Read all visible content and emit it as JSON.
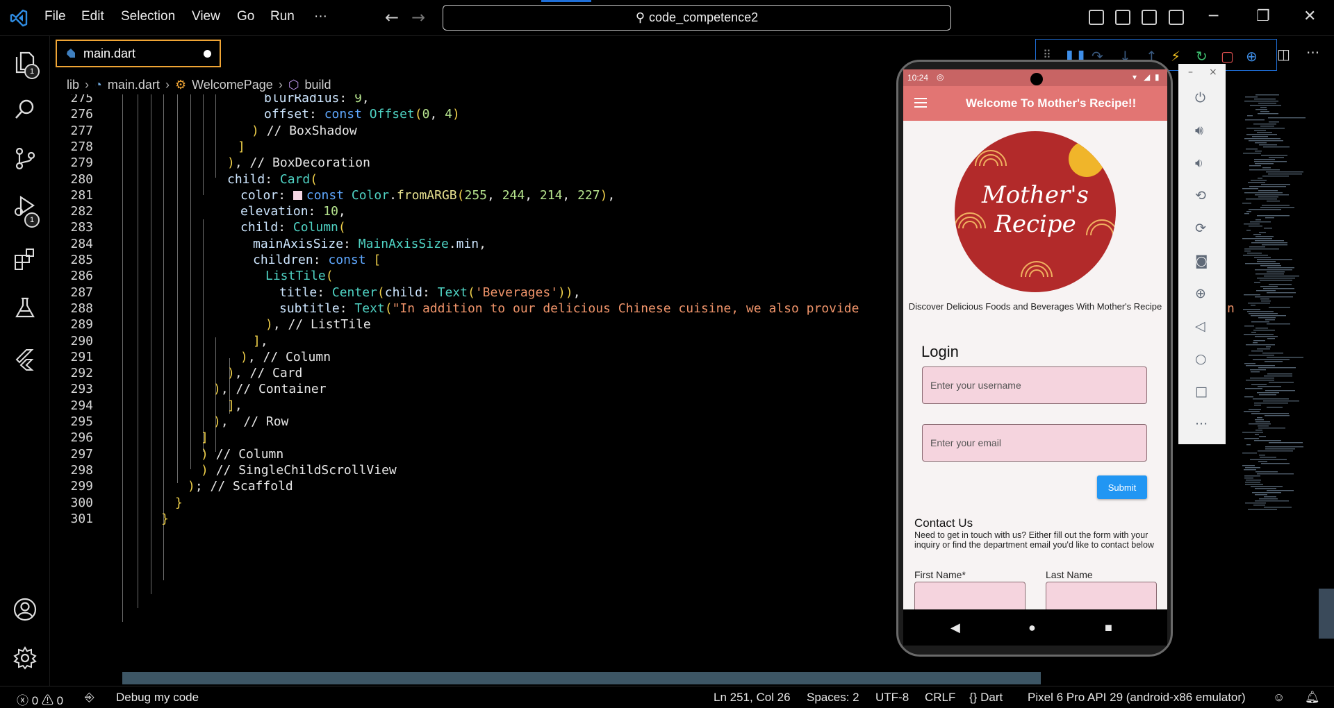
{
  "window": {
    "search_text": "code_competence2"
  },
  "menu": [
    "File",
    "Edit",
    "Selection",
    "View",
    "Go",
    "Run",
    "···"
  ],
  "tab": {
    "filename": "main.dart"
  },
  "breadcrumb": {
    "folder": "lib",
    "file": "main.dart",
    "class": "WelcomePage",
    "method": "build"
  },
  "code_lines": [
    {
      "num": "275",
      "text": "blurRadius: 9,"
    },
    {
      "num": "276",
      "text": "offset: const Offset(0, 4)"
    },
    {
      "num": "277",
      "text": ") // BoxShadow"
    },
    {
      "num": "278",
      "text": "]"
    },
    {
      "num": "279",
      "text": "), // BoxDecoration"
    },
    {
      "num": "280",
      "text": "child: Card("
    },
    {
      "num": "281",
      "text": "color: const Color.fromARGB(255, 244, 214, 227),"
    },
    {
      "num": "282",
      "text": "elevation: 10,"
    },
    {
      "num": "283",
      "text": "child: Column("
    },
    {
      "num": "284",
      "text": "mainAxisSize: MainAxisSize.min,"
    },
    {
      "num": "285",
      "text": "children: const ["
    },
    {
      "num": "286",
      "text": "ListTile("
    },
    {
      "num": "287",
      "text": "title: Center(child: Text('Beverages')),"
    },
    {
      "num": "288",
      "text": "subtitle: Text(\"In addition to our delicious Chinese cuisine, we also provide"
    },
    {
      "num": "289",
      "text": "), // ListTile"
    },
    {
      "num": "290",
      "text": "],"
    },
    {
      "num": "291",
      "text": "), // Column"
    },
    {
      "num": "292",
      "text": "), // Card"
    },
    {
      "num": "293",
      "text": "), // Container"
    },
    {
      "num": "294",
      "text": "],"
    },
    {
      "num": "295",
      "text": "),  // Row"
    },
    {
      "num": "296",
      "text": "]"
    },
    {
      "num": "297",
      "text": ") // Column"
    },
    {
      "num": "298",
      "text": ") // SingleChildScrollView"
    },
    {
      "num": "299",
      "text": "); // Scaffold"
    },
    {
      "num": "300",
      "text": "}"
    },
    {
      "num": "301",
      "text": "}"
    }
  ],
  "code_overflow_tail": "n",
  "phone": {
    "time": "10:24",
    "app_title": "Welcome To Mother's Recipe!!",
    "logo_line1": "Mother's",
    "logo_line2": "Recipe",
    "tagline": "Discover Delicious Foods and Beverages With Mother's Recipe",
    "login_title": "Login",
    "username_placeholder": "Enter your username",
    "email_placeholder": "Enter your email",
    "submit_label": "Submit",
    "contact_title": "Contact Us",
    "contact_desc": "Need to get in touch with us? Either fill out the form with your inquiry or find the department email you'd like to contact below",
    "first_name_label": "First Name*",
    "last_name_label": "Last Name"
  },
  "statusbar": {
    "errors": "0",
    "warnings": "0",
    "debug_label": "Debug my code",
    "position": "Ln 251, Col 26",
    "spaces": "Spaces: 2",
    "encoding": "UTF-8",
    "eol": "CRLF",
    "language": "Dart",
    "device": "Pixel 6 Pro API 29 (android-x86 emulator)"
  },
  "colors": {
    "accent_blue": "#1e6fd9",
    "tab_border": "#f0a535",
    "appbar": "#e27573",
    "submit": "#2196f3",
    "input_fill": "#f5d4de"
  },
  "badges": {
    "explorer": "1",
    "debug": "1"
  }
}
